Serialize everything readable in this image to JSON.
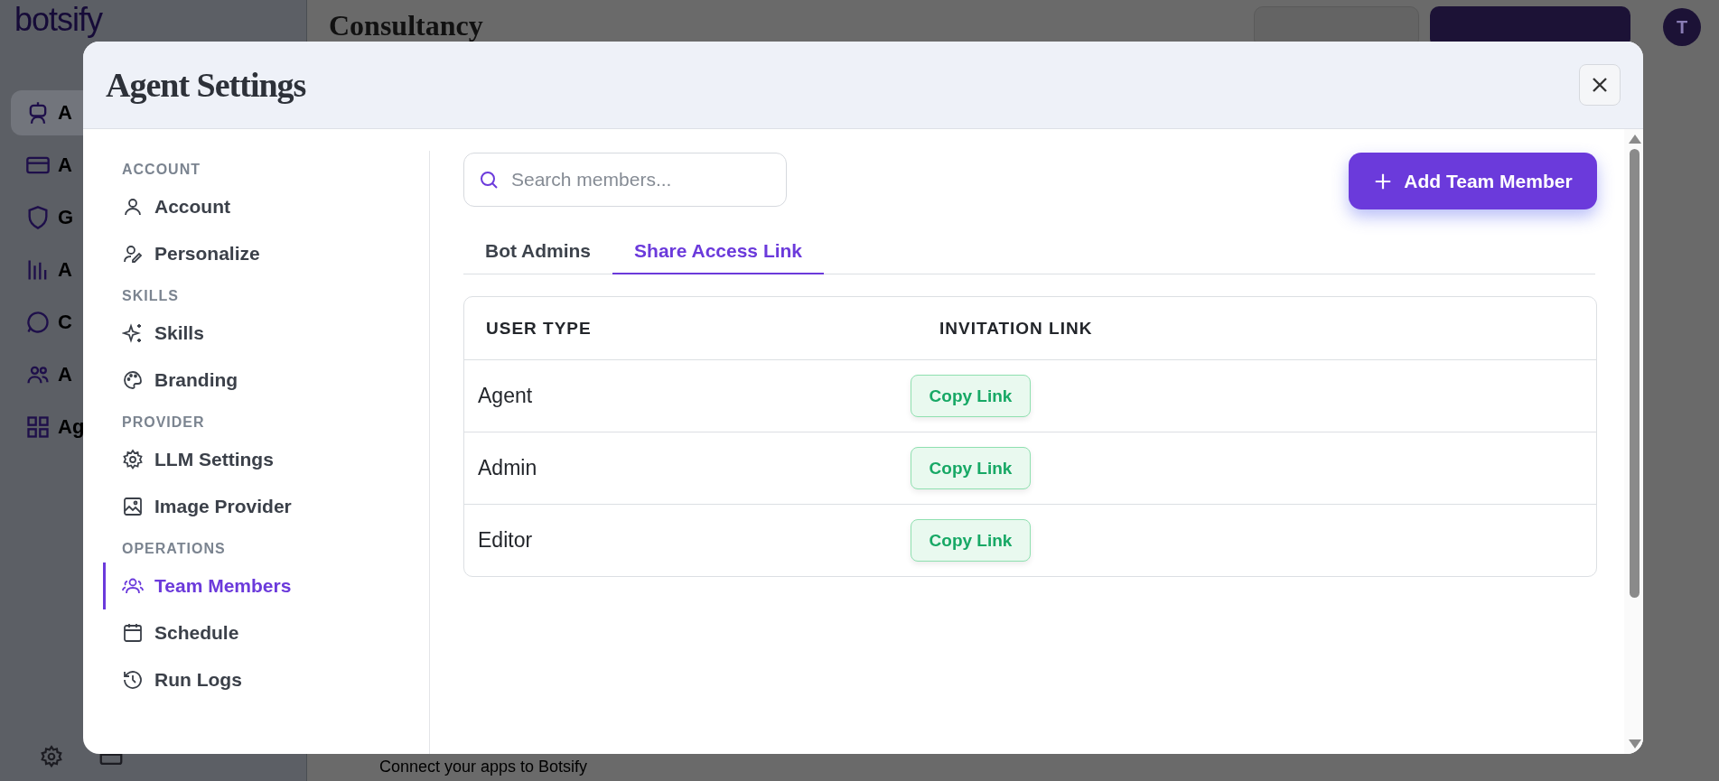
{
  "app": {
    "logo": "botsify",
    "page_title": "Consultancy",
    "avatar": "T",
    "sidebar": [
      {
        "label": "A",
        "selected": true
      },
      {
        "label": "A",
        "selected": false
      },
      {
        "label": "G",
        "selected": false
      },
      {
        "label": "A",
        "selected": false
      },
      {
        "label": "C",
        "selected": false
      },
      {
        "label": "A",
        "selected": false
      },
      {
        "label": "Ag",
        "selected": false
      }
    ],
    "footer": "Connect your apps to Botsify"
  },
  "modal": {
    "title": "Agent Settings",
    "nav": [
      {
        "heading": "ACCOUNT",
        "items": [
          {
            "label": "Account",
            "selected": false
          },
          {
            "label": "Personalize",
            "selected": false
          }
        ]
      },
      {
        "heading": "SKILLS",
        "items": [
          {
            "label": "Skills",
            "selected": false
          },
          {
            "label": "Branding",
            "selected": false
          }
        ]
      },
      {
        "heading": "PROVIDER",
        "items": [
          {
            "label": "LLM Settings",
            "selected": false
          },
          {
            "label": "Image Provider",
            "selected": false
          }
        ]
      },
      {
        "heading": "OPERATIONS",
        "items": [
          {
            "label": "Team Members",
            "selected": true
          },
          {
            "label": "Schedule",
            "selected": false
          },
          {
            "label": "Run Logs",
            "selected": false
          }
        ]
      }
    ],
    "search": {
      "placeholder": "Search members..."
    },
    "add_button": "Add Team Member",
    "tabs": [
      {
        "label": "Bot Admins",
        "selected": false
      },
      {
        "label": "Share Access Link",
        "selected": true
      }
    ],
    "table": {
      "columns": [
        "USER TYPE",
        "INVITATION LINK"
      ],
      "rows": [
        {
          "user_type": "Agent",
          "action": "Copy Link"
        },
        {
          "user_type": "Admin",
          "action": "Copy Link"
        },
        {
          "user_type": "Editor",
          "action": "Copy Link"
        }
      ]
    }
  }
}
